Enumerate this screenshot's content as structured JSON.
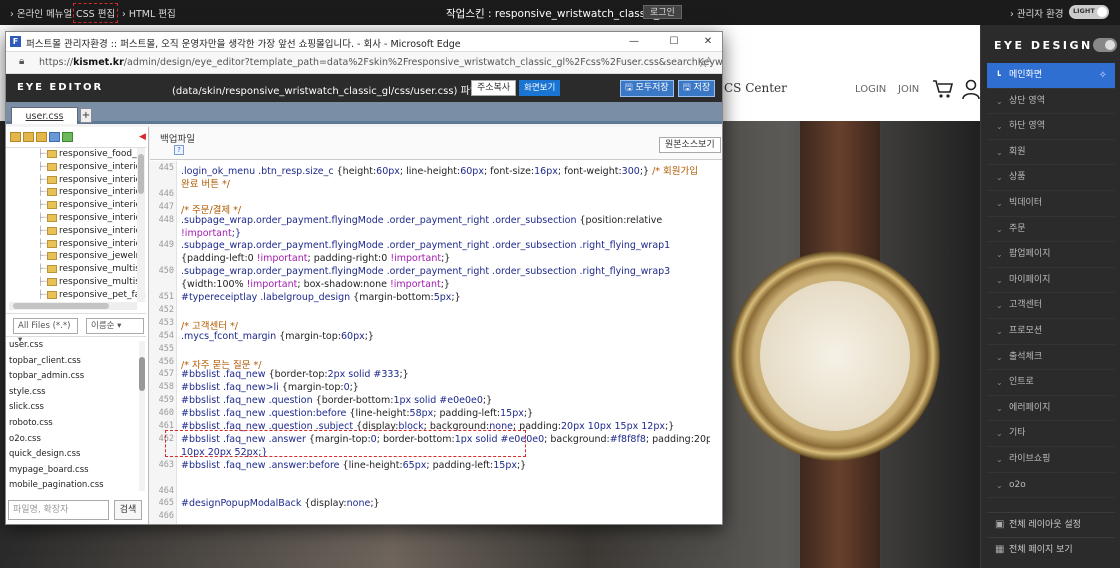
{
  "topbar": {
    "online_manual": "온라인 메뉴얼",
    "css_edit": "CSS 편집",
    "html_edit": "HTML 편집",
    "working_skin": "작업스킨 : responsive_wristwatch_classic_gl",
    "login": "로그인",
    "admin_env": "관리자 환경",
    "toggle_label": "LIGHT"
  },
  "site": {
    "cs_center": "CS Center",
    "login": "LOGIN",
    "join": "JOIN",
    "icons": [
      "cart-icon",
      "user-icon"
    ]
  },
  "right_panel": {
    "brand": "EYE DESIGN",
    "menu": [
      {
        "label": "메인화면",
        "active": true
      },
      {
        "label": "상단 영역"
      },
      {
        "label": "하단 영역"
      },
      {
        "label": "회원"
      },
      {
        "label": "상품"
      },
      {
        "label": "빅데이터"
      },
      {
        "label": "주문"
      },
      {
        "label": "팝업페이지"
      },
      {
        "label": "마이페이지"
      },
      {
        "label": "고객센터"
      },
      {
        "label": "프로모션"
      },
      {
        "label": "출석체크"
      },
      {
        "label": "인트로"
      },
      {
        "label": "에러페이지"
      },
      {
        "label": "기타"
      },
      {
        "label": "라이브쇼핑"
      },
      {
        "label": "o2o"
      }
    ],
    "layout_settings": "전체 레이아웃 설정",
    "view_all_pages": "전체 페이지 보기"
  },
  "window": {
    "title": "퍼스트몰 관리자환경 :: 퍼스트몰, 오직 운영자만을 생각한 가장 앞선 쇼핑몰입니다. - 회사 - Microsoft Edge",
    "url_prefix": "https://",
    "url_domain": "kismet.kr",
    "url_rest": "/admin/design/eye_editor?template_path=data%2Fskin%2Fresponsive_wristwatch_classic_gl%2Fcss%2Fuser.css&searchKeyword=..."
  },
  "editor": {
    "logo": "EYE EDITOR",
    "file_path": "(data/skin/responsive_wristwatch_classic_gl/css/user.css) 파일",
    "copy_address": "주소복사",
    "view_screen": "화면보기",
    "save_all": "모두저장",
    "save": "저장",
    "tab": "user.css",
    "add_tab": "+",
    "backup_file": "백업파일",
    "help": "?",
    "original_source": "원본소스보기",
    "tree_items": [
      "responsive_food_w",
      "responsive_interior",
      "responsive_interior",
      "responsive_interior",
      "responsive_interior",
      "responsive_interior",
      "responsive_interior",
      "responsive_interior",
      "responsive_jewelry",
      "responsive_multish",
      "responsive_multish",
      "responsive_pet_fan"
    ],
    "filter_files": "All Files (*.*)",
    "filter_sort": "이름순",
    "files": [
      "user.css",
      "topbar_client.css",
      "topbar_admin.css",
      "style.css",
      "slick.css",
      "roboto.css",
      "o2o.css",
      "quick_design.css",
      "mypage_board.css",
      "mobile_pagination.css"
    ],
    "search_placeholder": "파일명, 확장자",
    "search_button": "검색",
    "code_lines": [
      {
        "n": "445",
        "t": ".login_ok_menu .btn_resp.size_c {height:60px; line-height:60px; font-size:16px; font-weight:300;} /* 회원가입"
      },
      {
        "n": "",
        "t": "완료 버튼 */"
      },
      {
        "n": "446",
        "t": ""
      },
      {
        "n": "447",
        "t": "/* 주문/결제 */"
      },
      {
        "n": "448",
        "t": ".subpage_wrap.order_payment.flyingMode .order_payment_right .order_subsection {position:relative"
      },
      {
        "n": "",
        "t": "!important;}"
      },
      {
        "n": "449",
        "t": ".subpage_wrap.order_payment.flyingMode .order_payment_right .order_subsection .right_flying_wrap1"
      },
      {
        "n": "",
        "t": "{padding-left:0 !important; padding-right:0 !important;}"
      },
      {
        "n": "450",
        "t": ".subpage_wrap.order_payment.flyingMode .order_payment_right .order_subsection .right_flying_wrap3"
      },
      {
        "n": "",
        "t": "{width:100% !important; box-shadow:none !important;}"
      },
      {
        "n": "451",
        "t": "#typereceiptlay .labelgroup_design {margin-bottom:5px;}"
      },
      {
        "n": "452",
        "t": ""
      },
      {
        "n": "453",
        "t": "/* 고객센터 */"
      },
      {
        "n": "454",
        "t": ".mycs_fcont_margin {margin-top:60px;}"
      },
      {
        "n": "455",
        "t": ""
      },
      {
        "n": "456",
        "t": "/* 자주 묻는 질문 */"
      },
      {
        "n": "457",
        "t": "#bbslist .faq_new {border-top:2px solid #333;}"
      },
      {
        "n": "458",
        "t": "#bbslist .faq_new>li {margin-top:0;}"
      },
      {
        "n": "459",
        "t": "#bbslist .faq_new .question {border-bottom:1px solid #e0e0e0;}"
      },
      {
        "n": "460",
        "t": "#bbslist .faq_new .question:before {line-height:58px; padding-left:15px;}"
      },
      {
        "n": "461",
        "t": "#bbslist .faq_new .question .subject {display:block; background:none; padding:20px 10px 15px 12px;}"
      },
      {
        "n": "462",
        "t": "#bbslist .faq_new .answer {margin-top:0; border-bottom:1px solid #e0e0e0; background:#f8f8f8; padding:20px"
      },
      {
        "n": "",
        "t": "10px 20px 52px;}"
      },
      {
        "n": "463",
        "t": "#bbslist .faq_new .answer:before {line-height:65px; padding-left:15px;}"
      },
      {
        "n": "",
        "t": ""
      },
      {
        "n": "464",
        "t": ""
      },
      {
        "n": "465",
        "t": "#designPopupModalBack {display:none;}"
      },
      {
        "n": "466",
        "t": ""
      }
    ]
  }
}
